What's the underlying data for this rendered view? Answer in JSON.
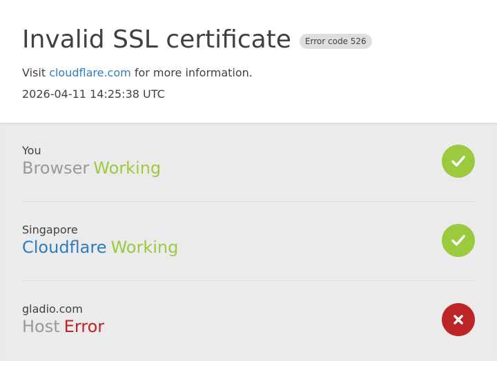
{
  "header": {
    "title": "Invalid SSL certificate",
    "error_badge": "Error code 526",
    "visit_prefix": "Visit",
    "visit_link": "cloudflare.com",
    "visit_suffix": "for more information.",
    "timestamp": "2026-04-11 14:25:38 UTC"
  },
  "colors": {
    "working": "#9bca3e",
    "error": "#bd2426",
    "link": "#2f7bbf",
    "panel_bg": "#ebebeb"
  },
  "rows": [
    {
      "location": "You",
      "service": "Browser",
      "status": "Working",
      "state": "ok",
      "icon": "check-icon"
    },
    {
      "location": "Singapore",
      "service": "Cloudflare",
      "status": "Working",
      "state": "ok",
      "icon": "check-icon"
    },
    {
      "location": "gladio.com",
      "service": "Host",
      "status": "Error",
      "state": "error",
      "icon": "close-icon"
    }
  ]
}
